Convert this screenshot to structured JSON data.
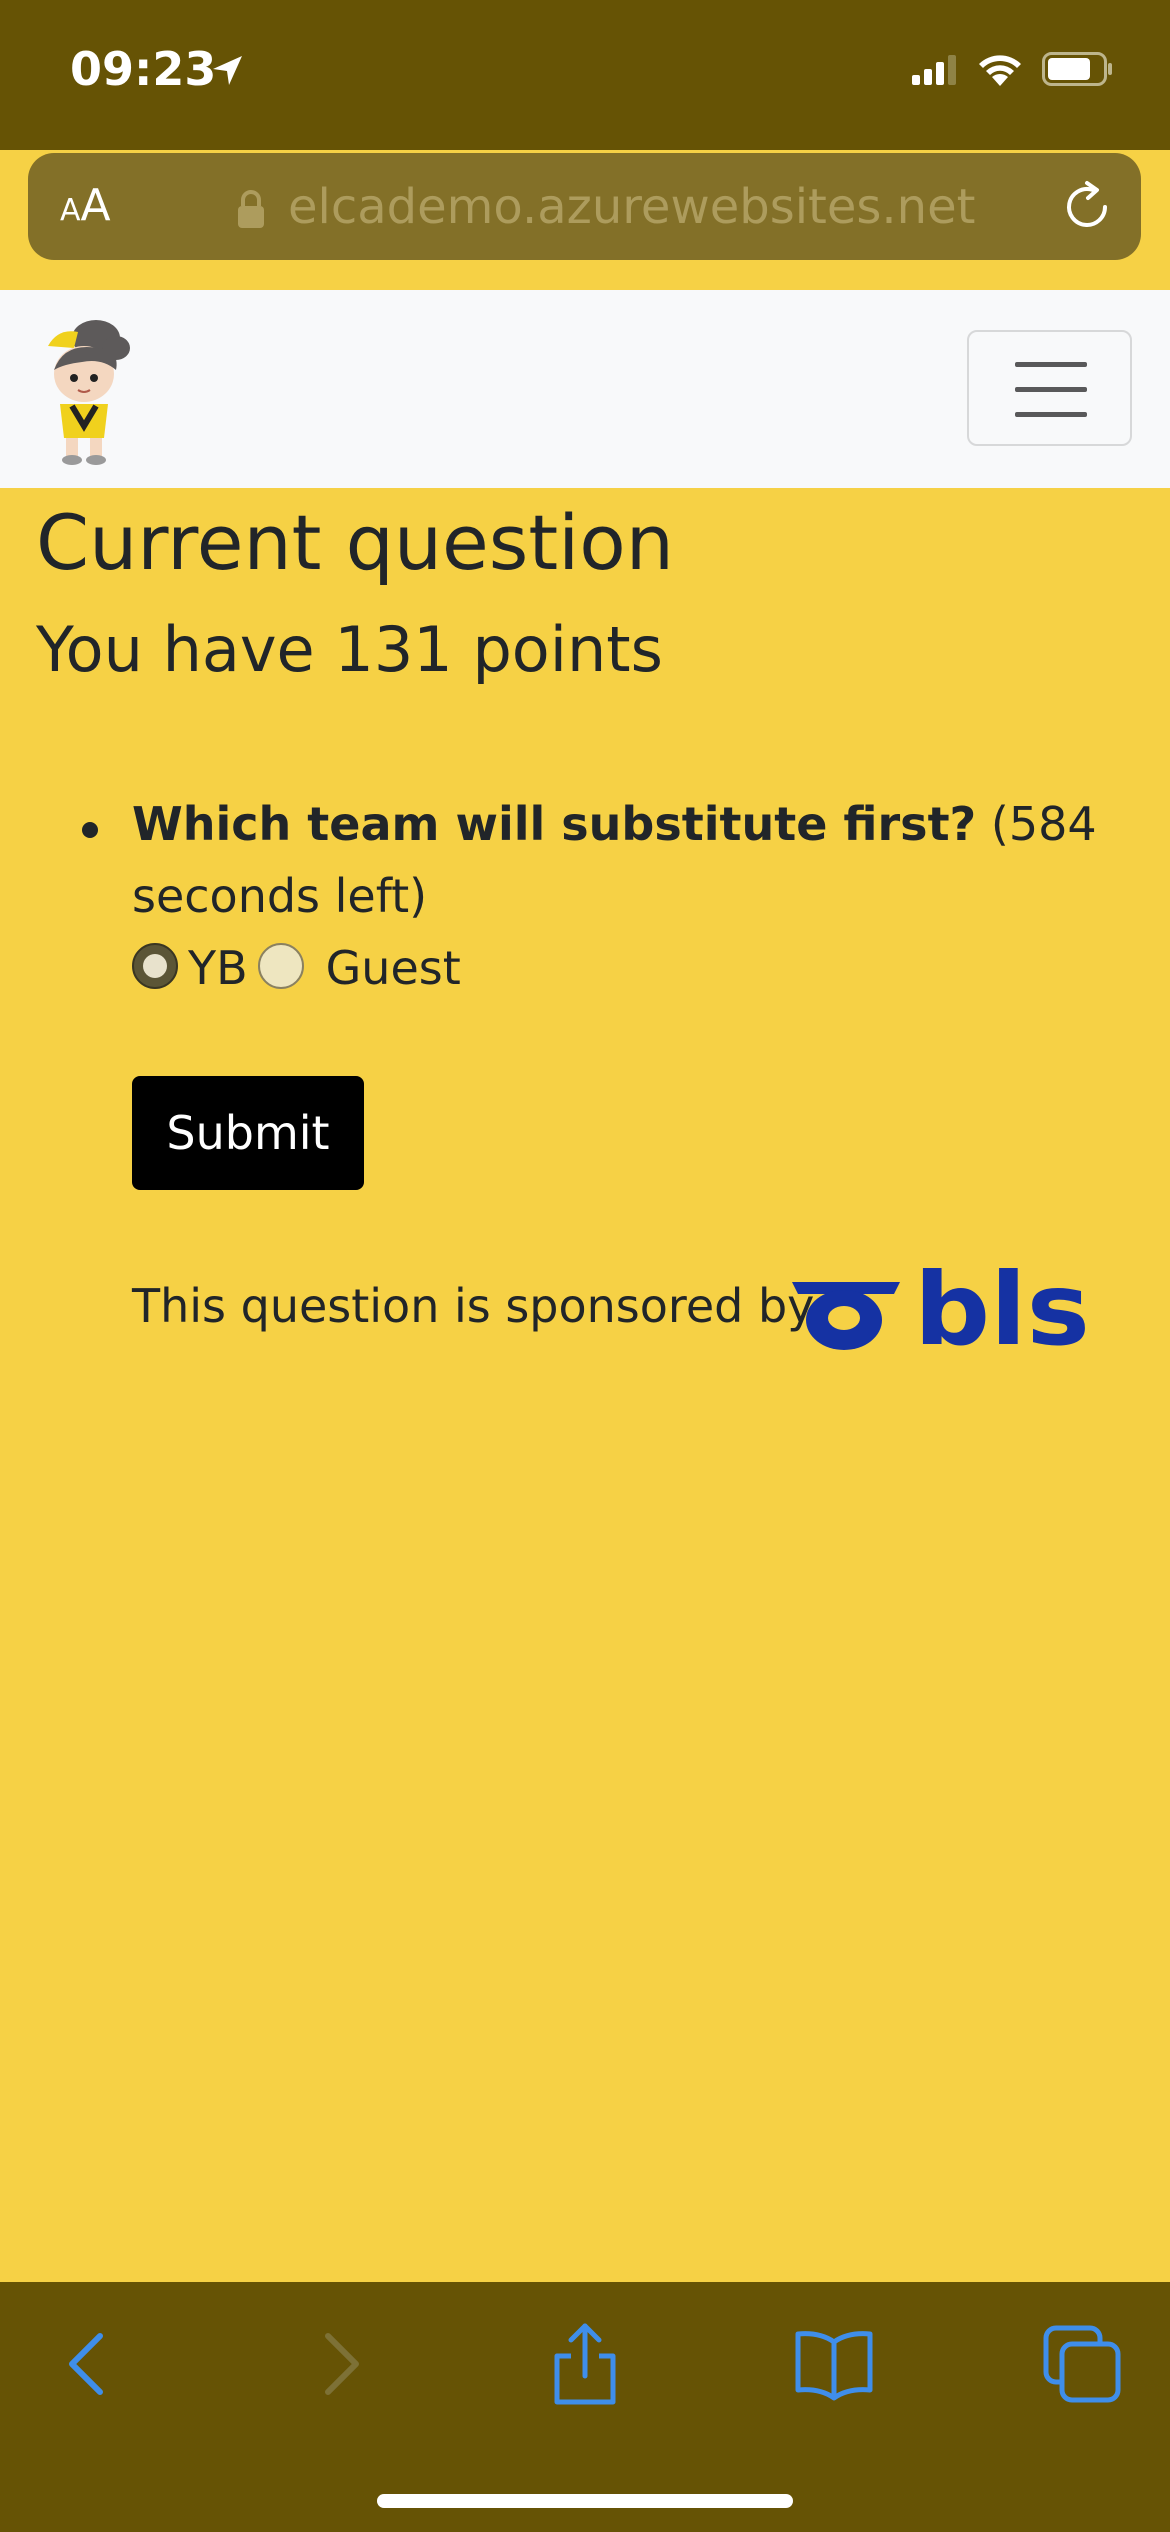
{
  "status_bar": {
    "time": "09:23"
  },
  "browser": {
    "text_size_label_small": "A",
    "text_size_label_large": "A",
    "url": "elcademo.azurewebsites.net"
  },
  "page": {
    "title": "Current question",
    "points_text": "You have 131 points",
    "question": {
      "text": "Which team will substitute first?",
      "time_left": "(584 seconds left)",
      "options": [
        {
          "label": "YB",
          "selected": true
        },
        {
          "label": "Guest",
          "selected": false
        }
      ]
    },
    "submit_label": "Submit",
    "sponsor_text": "This question is sponsored by",
    "sponsor_logo_text": "bls"
  },
  "colors": {
    "page_background": "#f6d145",
    "browser_chrome": "#665305",
    "sponsor_blue": "#1532a3",
    "toolbar_icon_blue": "#3f8eea"
  },
  "icons": {
    "status": [
      "location-arrow-icon",
      "signal-icon",
      "wifi-icon",
      "battery-icon"
    ],
    "toolbar": [
      "back-icon",
      "forward-icon",
      "share-icon",
      "bookmarks-icon",
      "tabs-icon"
    ]
  }
}
